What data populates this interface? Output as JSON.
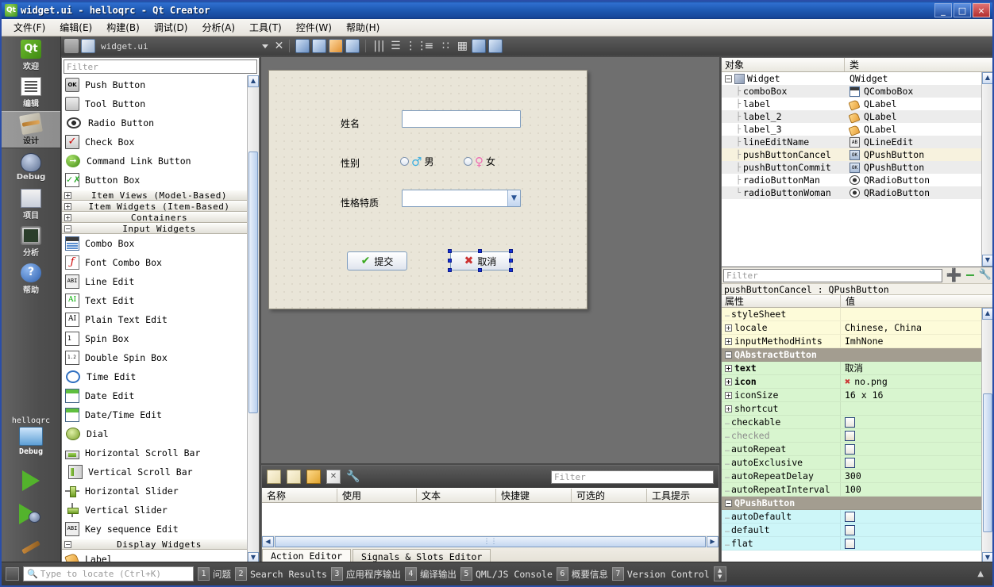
{
  "window": {
    "title": "widget.ui - helloqrc - Qt Creator",
    "app_icon": "qt-icon",
    "minimize": "_",
    "maximize": "□",
    "close": "×"
  },
  "menubar": {
    "items": [
      {
        "label": "文件(F)",
        "name": "menu-file"
      },
      {
        "label": "编辑(E)",
        "name": "menu-edit"
      },
      {
        "label": "构建(B)",
        "name": "menu-build"
      },
      {
        "label": "调试(D)",
        "name": "menu-debug"
      },
      {
        "label": "分析(A)",
        "name": "menu-analyze"
      },
      {
        "label": "工具(T)",
        "name": "menu-tools"
      },
      {
        "label": "控件(W)",
        "name": "menu-widgets"
      },
      {
        "label": "帮助(H)",
        "name": "menu-help"
      }
    ]
  },
  "mode_rail": {
    "modes": [
      {
        "label": "欢迎",
        "icon": "qt-welcome-icon",
        "active": false
      },
      {
        "label": "编辑",
        "icon": "edit-icon",
        "active": false
      },
      {
        "label": "设计",
        "icon": "design-icon",
        "active": true
      },
      {
        "label": "Debug",
        "icon": "debug-bug-icon",
        "active": false
      },
      {
        "label": "项目",
        "icon": "projects-icon",
        "active": false
      },
      {
        "label": "分析",
        "icon": "analyze-icon",
        "active": false
      },
      {
        "label": "帮助",
        "icon": "help-icon",
        "active": false
      }
    ],
    "kit_selector": {
      "project": "helloqrc",
      "build_config": "Debug",
      "icon": "computer-icon"
    },
    "run_button": "run-icon",
    "debug_button": "start-debug-icon",
    "build_button": "build-hammer-icon"
  },
  "editor_toolbar": {
    "lock_icon": "unlock-icon",
    "file_icon": "ui-file-icon",
    "filename": "widget.ui",
    "dropdown_icon": "chevron-down-icon",
    "close_icon": "close-icon",
    "buttons": [
      {
        "name": "edit-widgets-button",
        "icon": "edit-widgets-icon"
      },
      {
        "name": "edit-signals-slots-button",
        "icon": "signals-slots-icon"
      },
      {
        "name": "edit-buddies-button",
        "icon": "buddies-icon"
      },
      {
        "name": "edit-tab-order-button",
        "icon": "tab-order-icon"
      },
      {
        "name": "layout-horizontally-button",
        "icon": "layout-h-icon"
      },
      {
        "name": "layout-vertically-button",
        "icon": "layout-v-icon"
      },
      {
        "name": "layout-splitter-h-button",
        "icon": "splitter-h-icon"
      },
      {
        "name": "layout-splitter-v-button",
        "icon": "splitter-v-icon"
      },
      {
        "name": "layout-form-button",
        "icon": "layout-form-icon"
      },
      {
        "name": "layout-grid-button",
        "icon": "layout-grid-icon"
      },
      {
        "name": "break-layout-button",
        "icon": "break-layout-icon"
      },
      {
        "name": "adjust-size-button",
        "icon": "adjust-size-icon"
      }
    ]
  },
  "widget_box": {
    "filter_placeholder": "Filter",
    "groups": [
      {
        "expanded": true,
        "header": null,
        "items": [
          {
            "label": "Push Button",
            "icon": "push-button-icon"
          },
          {
            "label": "Tool Button",
            "icon": "tool-button-icon"
          },
          {
            "label": "Radio Button",
            "icon": "radio-button-icon"
          },
          {
            "label": "Check Box",
            "icon": "check-box-icon"
          },
          {
            "label": "Command Link Button",
            "icon": "command-link-icon"
          },
          {
            "label": "Button Box",
            "icon": "button-box-icon"
          }
        ]
      },
      {
        "expanded": false,
        "header": "Item Views (Model-Based)",
        "items": []
      },
      {
        "expanded": false,
        "header": "Item Widgets (Item-Based)",
        "items": []
      },
      {
        "expanded": false,
        "header": "Containers",
        "items": []
      },
      {
        "expanded": true,
        "header": "Input Widgets",
        "items": [
          {
            "label": "Combo Box",
            "icon": "combo-box-icon"
          },
          {
            "label": "Font Combo Box",
            "icon": "font-combo-icon"
          },
          {
            "label": "Line Edit",
            "icon": "line-edit-icon"
          },
          {
            "label": "Text Edit",
            "icon": "text-edit-icon"
          },
          {
            "label": "Plain Text Edit",
            "icon": "plain-text-edit-icon"
          },
          {
            "label": "Spin Box",
            "icon": "spin-box-icon"
          },
          {
            "label": "Double Spin Box",
            "icon": "double-spin-box-icon"
          },
          {
            "label": "Time Edit",
            "icon": "time-edit-icon"
          },
          {
            "label": "Date Edit",
            "icon": "date-edit-icon"
          },
          {
            "label": "Date/Time Edit",
            "icon": "date-time-edit-icon"
          },
          {
            "label": "Dial",
            "icon": "dial-icon"
          },
          {
            "label": "Horizontal Scroll Bar",
            "icon": "h-scroll-bar-icon"
          },
          {
            "label": "Vertical Scroll Bar",
            "icon": "v-scroll-bar-icon"
          },
          {
            "label": "Horizontal Slider",
            "icon": "h-slider-icon"
          },
          {
            "label": "Vertical Slider",
            "icon": "v-slider-icon"
          },
          {
            "label": "Key sequence Edit",
            "icon": "key-sequence-edit-icon"
          }
        ]
      },
      {
        "expanded": true,
        "header": "Display Widgets",
        "items": [
          {
            "label": "Label",
            "icon": "label-icon"
          }
        ]
      }
    ]
  },
  "form": {
    "fields": [
      {
        "label": "姓名",
        "type": "lineedit",
        "value": ""
      },
      {
        "label": "性别",
        "type": "radios"
      },
      {
        "label": "性格特质",
        "type": "combobox",
        "value": ""
      }
    ],
    "radios": [
      {
        "label": "男",
        "symbol": "♂",
        "checked": false,
        "color": "#3aaee0"
      },
      {
        "label": "女",
        "symbol": "♀",
        "checked": false,
        "color": "#ef6fb3"
      }
    ],
    "buttons": [
      {
        "label": "提交",
        "icon": "check-mark-icon",
        "selected": false
      },
      {
        "label": "取消",
        "icon": "red-x-icon",
        "selected": true
      }
    ]
  },
  "object_inspector": {
    "columns": [
      "对象",
      "类"
    ],
    "rows": [
      {
        "name": "Widget",
        "class": "QWidget",
        "depth": 0,
        "icon": "widget-icon",
        "selected": false
      },
      {
        "name": "comboBox",
        "class": "QComboBox",
        "depth": 1,
        "icon": "combo-box-icon",
        "selected": false
      },
      {
        "name": "label",
        "class": "QLabel",
        "depth": 1,
        "icon": "label-icon",
        "selected": false
      },
      {
        "name": "label_2",
        "class": "QLabel",
        "depth": 1,
        "icon": "label-icon",
        "selected": false
      },
      {
        "name": "label_3",
        "class": "QLabel",
        "depth": 1,
        "icon": "label-icon",
        "selected": false
      },
      {
        "name": "lineEditName",
        "class": "QLineEdit",
        "depth": 1,
        "icon": "line-edit-icon",
        "selected": false
      },
      {
        "name": "pushButtonCancel",
        "class": "QPushButton",
        "depth": 1,
        "icon": "push-button-icon",
        "selected": true
      },
      {
        "name": "pushButtonCommit",
        "class": "QPushButton",
        "depth": 1,
        "icon": "push-button-icon",
        "selected": false
      },
      {
        "name": "radioButtonMan",
        "class": "QRadioButton",
        "depth": 1,
        "icon": "radio-button-icon",
        "selected": false
      },
      {
        "name": "radioButtonWoman",
        "class": "QRadioButton",
        "depth": 1,
        "icon": "radio-button-icon",
        "selected": false
      }
    ]
  },
  "property_editor": {
    "filter_placeholder": "Filter",
    "add_icon": "plus-icon",
    "remove_icon": "minus-icon",
    "configure_icon": "wrench-icon",
    "object_line": "pushButtonCancel : QPushButton",
    "columns": [
      "属性",
      "值"
    ],
    "rows": [
      {
        "name": "styleSheet",
        "value": "",
        "kind": "yellow",
        "expandable": false
      },
      {
        "name": "locale",
        "value": "Chinese, China",
        "kind": "yellow",
        "expandable": true
      },
      {
        "name": "inputMethodHints",
        "value": "ImhNone",
        "kind": "yellow",
        "expandable": true
      },
      {
        "name": "QAbstractButton",
        "value": "",
        "kind": "group",
        "expandable": true,
        "expanded": true
      },
      {
        "name": "text",
        "value": "取消",
        "kind": "green",
        "expandable": true,
        "bold": true
      },
      {
        "name": "icon",
        "value": "no.png",
        "kind": "green",
        "expandable": true,
        "bold": true,
        "value_icon": "red-x-icon"
      },
      {
        "name": "iconSize",
        "value": "16 x 16",
        "kind": "green",
        "expandable": true
      },
      {
        "name": "shortcut",
        "value": "",
        "kind": "green",
        "expandable": true
      },
      {
        "name": "checkable",
        "value": "",
        "kind": "green",
        "expandable": false,
        "checkbox": true,
        "checked": false
      },
      {
        "name": "checked",
        "value": "",
        "kind": "green",
        "expandable": false,
        "checkbox": true,
        "checked": false,
        "disabled": true
      },
      {
        "name": "autoRepeat",
        "value": "",
        "kind": "green",
        "expandable": false,
        "checkbox": true,
        "checked": false
      },
      {
        "name": "autoExclusive",
        "value": "",
        "kind": "green",
        "expandable": false,
        "checkbox": true,
        "checked": false
      },
      {
        "name": "autoRepeatDelay",
        "value": "300",
        "kind": "green",
        "expandable": false
      },
      {
        "name": "autoRepeatInterval",
        "value": "100",
        "kind": "green",
        "expandable": false
      },
      {
        "name": "QPushButton",
        "value": "",
        "kind": "group",
        "expandable": true,
        "expanded": true
      },
      {
        "name": "autoDefault",
        "value": "",
        "kind": "cyan",
        "expandable": false,
        "checkbox": true,
        "checked": false
      },
      {
        "name": "default",
        "value": "",
        "kind": "cyan",
        "expandable": false,
        "checkbox": true,
        "checked": false
      },
      {
        "name": "flat",
        "value": "",
        "kind": "cyan",
        "expandable": false,
        "checkbox": true,
        "checked": false
      }
    ]
  },
  "action_editor": {
    "toolbar_icons": [
      {
        "name": "new-action-button",
        "icon": "new-file-icon"
      },
      {
        "name": "copy-action-button",
        "icon": "copy-icon"
      },
      {
        "name": "edit-action-button",
        "icon": "edit-pencil-icon"
      },
      {
        "name": "delete-action-button",
        "icon": "delete-icon"
      },
      {
        "name": "configure-button",
        "icon": "wrench-icon"
      }
    ],
    "filter_placeholder": "Filter",
    "columns": [
      "名称",
      "使用",
      "文本",
      "快捷键",
      "可选的",
      "工具提示"
    ],
    "rows": [],
    "tabs": [
      {
        "label": "Action Editor",
        "active": true
      },
      {
        "label": "Signals & Slots Editor",
        "active": false
      }
    ]
  },
  "status_bar": {
    "toggle_sidebar_icon": "toggle-sidebar-icon",
    "locate_placeholder": "Type to locate (Ctrl+K)",
    "search_icon": "search-icon",
    "panes": [
      {
        "num": "1",
        "label": "问题",
        "cjk": true
      },
      {
        "num": "2",
        "label": "Search Results",
        "cjk": false
      },
      {
        "num": "3",
        "label": "应用程序输出",
        "cjk": true
      },
      {
        "num": "4",
        "label": "编译输出",
        "cjk": true
      },
      {
        "num": "5",
        "label": "QML/JS Console",
        "cjk": false
      },
      {
        "num": "6",
        "label": "概要信息",
        "cjk": true
      },
      {
        "num": "7",
        "label": "Version Control",
        "cjk": false
      }
    ],
    "expand_icon": "expand-collapse-icon",
    "collapse_arrow": "▲"
  }
}
